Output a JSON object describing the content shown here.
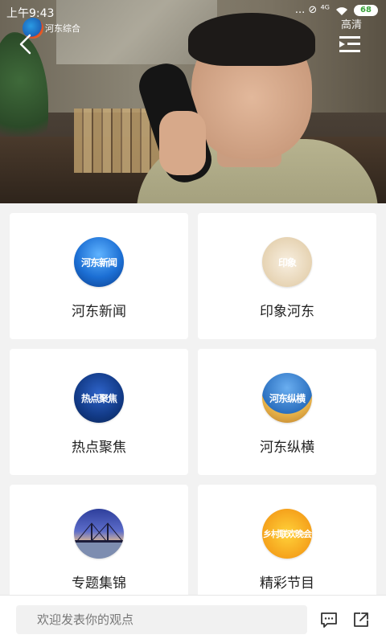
{
  "status_bar": {
    "time": "上午9:43",
    "signal": "... ⊘ ⁴ᴳ",
    "battery": "68"
  },
  "player": {
    "channel_logo": "河东综合",
    "quality": "高清",
    "back_icon": "back-arrow-icon",
    "playlist_icon": "playlist-icon"
  },
  "sections": [
    {
      "label": "河东新闻",
      "thumb_text": "河东新闻",
      "icon": "hedong-news-thumb"
    },
    {
      "label": "印象河东",
      "thumb_text": "印象",
      "icon": "impression-hedong-thumb"
    },
    {
      "label": "热点聚焦",
      "thumb_text": "热点聚焦",
      "icon": "hot-focus-thumb"
    },
    {
      "label": "河东纵横",
      "thumb_text": "河东纵横",
      "icon": "hedong-panorama-thumb"
    },
    {
      "label": "专题集锦",
      "thumb_text": "",
      "icon": "special-topics-thumb"
    },
    {
      "label": "精彩节目",
      "thumb_text": "乡村联欢晚会",
      "icon": "featured-programs-thumb"
    }
  ],
  "bottom_bar": {
    "comment_placeholder": "欢迎发表你的观点",
    "comment_icon": "comment-icon",
    "share_icon": "share-icon"
  },
  "colors": {
    "background": "#f2f2f2",
    "card": "#ffffff",
    "label_text": "#222222",
    "input_bg": "#f1f1f1"
  }
}
